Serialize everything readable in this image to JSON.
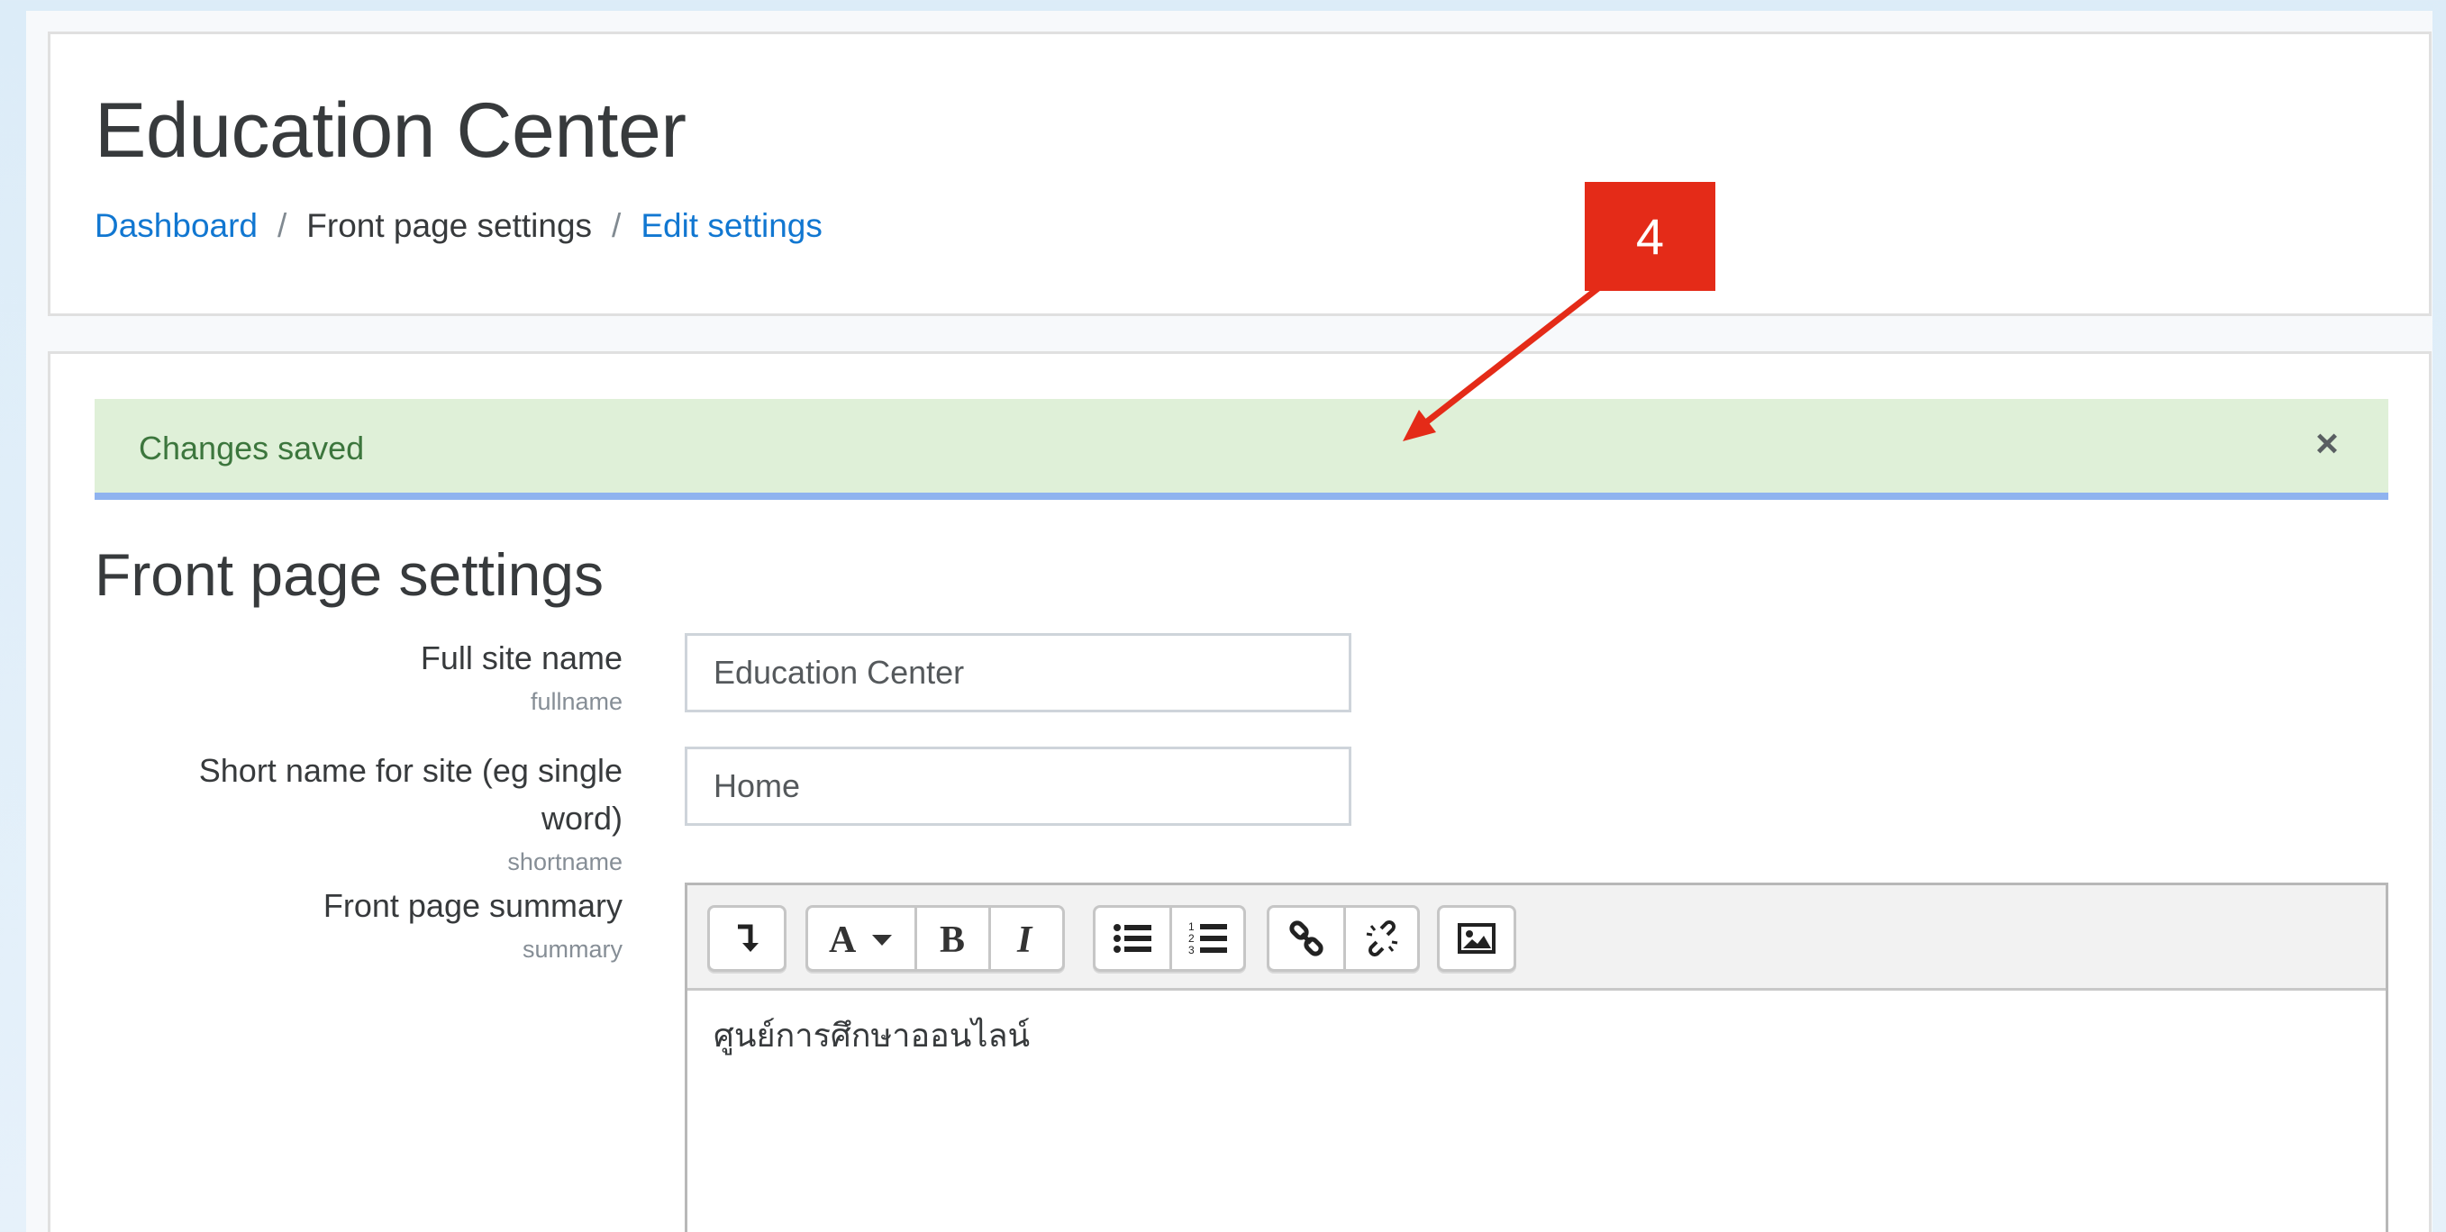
{
  "header": {
    "site_title": "Education Center",
    "breadcrumb": {
      "dashboard": "Dashboard",
      "front_page_settings": "Front page settings",
      "edit_settings": "Edit settings",
      "separator": "/"
    }
  },
  "alert": {
    "message": "Changes saved",
    "close_label": "×"
  },
  "page_heading": "Front page settings",
  "form": {
    "fullname": {
      "label": "Full site name",
      "key": "fullname",
      "value": "Education Center"
    },
    "shortname": {
      "label_line1": "Short name for site (eg single",
      "label_line2": "word)",
      "key": "shortname",
      "value": "Home"
    },
    "summary": {
      "label": "Front page summary",
      "key": "summary",
      "content": "ศูนย์การศึกษาออนไลน์",
      "toolbar_icons": [
        "expand-toolbar-icon",
        "font-style-icon",
        "bold-icon",
        "italic-icon",
        "unordered-list-icon",
        "ordered-list-icon",
        "link-icon",
        "unlink-icon",
        "image-icon"
      ]
    }
  },
  "annotation": {
    "number": "4",
    "color": "#e42b18"
  },
  "colors": {
    "link": "#1177d1",
    "alert_bg": "#dff0d8",
    "alert_text": "#3c763d",
    "alert_border": "#8fb3ef"
  }
}
